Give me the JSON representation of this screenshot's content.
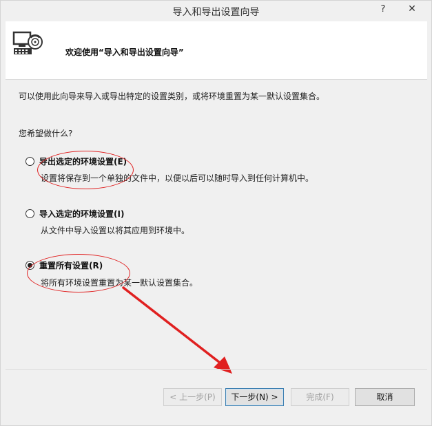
{
  "window": {
    "title": "导入和导出设置向导",
    "help_glyph": "?",
    "close_glyph": "✕"
  },
  "header": {
    "welcome": "欢迎使用“导入和导出设置向导”",
    "icon": "settings-computer-disc-icon"
  },
  "body": {
    "description": "可以使用此向导来导入或导出特定的设置类别，或将环境重置为某一默认设置集合。",
    "question": "您希望做什么?"
  },
  "options": [
    {
      "label": "导出选定的环境设置(E)",
      "description": "设置将保存到一个单独的文件中，以便以后可以随时导入到任何计算机中。",
      "selected": false
    },
    {
      "label": "导入选定的环境设置(I)",
      "description": "从文件中导入设置以将其应用到环境中。",
      "selected": false
    },
    {
      "label": "重置所有设置(R)",
      "description": "将所有环境设置重置为某一默认设置集合。",
      "selected": true
    }
  ],
  "buttons": {
    "back": "< 上一步(P)",
    "next": "下一步(N) >",
    "finish": "完成(F)",
    "cancel": "取消"
  },
  "colors": {
    "annotation": "#e02020",
    "default_button_border": "#3c7fb1"
  }
}
